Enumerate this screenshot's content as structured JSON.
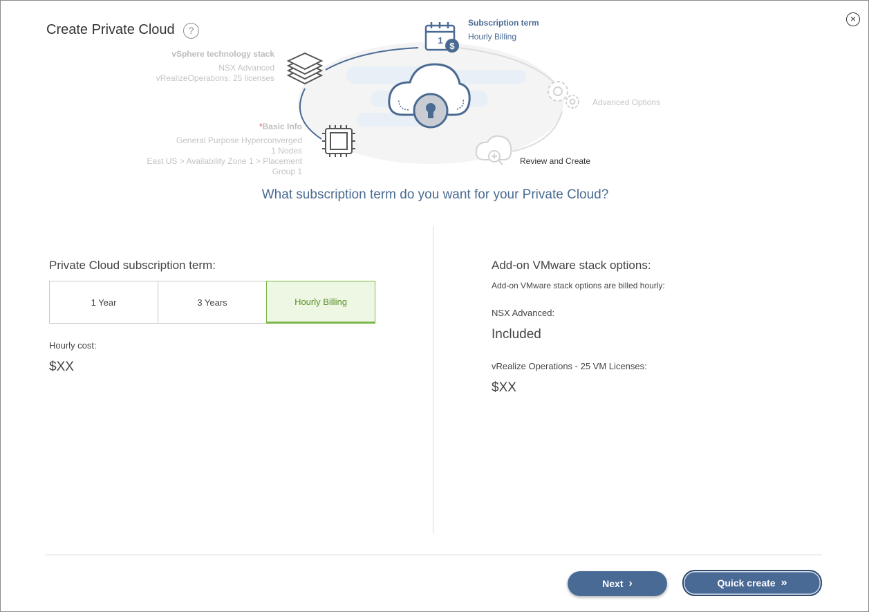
{
  "dialog": {
    "title": "Create Private Cloud",
    "help_symbol": "?",
    "close_symbol": "×"
  },
  "wheel": {
    "subscription": {
      "title": "Subscription term",
      "value": "Hourly Billing",
      "calendar_day": "1"
    },
    "vsphere": {
      "title": "vSphere technology stack",
      "line1": "NSX Advanced",
      "line2": "vRealizeOperations: 25 licenses"
    },
    "basic_info": {
      "required_mark": "*",
      "title": "Basic Info",
      "line1": "General Purpose Hyperconverged",
      "line2": "1 Nodes",
      "line3": "East US > Availability Zone 1 > Placement",
      "line4": "Group 1"
    },
    "advanced": {
      "title": "Advanced Options"
    },
    "review": {
      "title": "Review and Create"
    }
  },
  "question": "What subscription term do you want for your Private Cloud?",
  "left": {
    "section_label": "Private Cloud subscription term:",
    "options": [
      "1 Year",
      "3 Years",
      "Hourly Billing"
    ],
    "selected": "Hourly Billing",
    "cost_label": "Hourly cost:",
    "cost_value": "$XX"
  },
  "right": {
    "section_label": "Add-on VMware stack options:",
    "note": "Add-on VMware stack options are billed hourly:",
    "nsx_label": "NSX Advanced:",
    "nsx_value": "Included",
    "vrops_label": "vRealize Operations - 25 VM Licenses:",
    "vrops_value": "$XX"
  },
  "footer": {
    "next_label": "Next",
    "quick_label": "Quick create"
  },
  "colors": {
    "accent": "#4a6a96",
    "selected_fill": "#eef7e4",
    "selected_border": "#7ab648"
  }
}
